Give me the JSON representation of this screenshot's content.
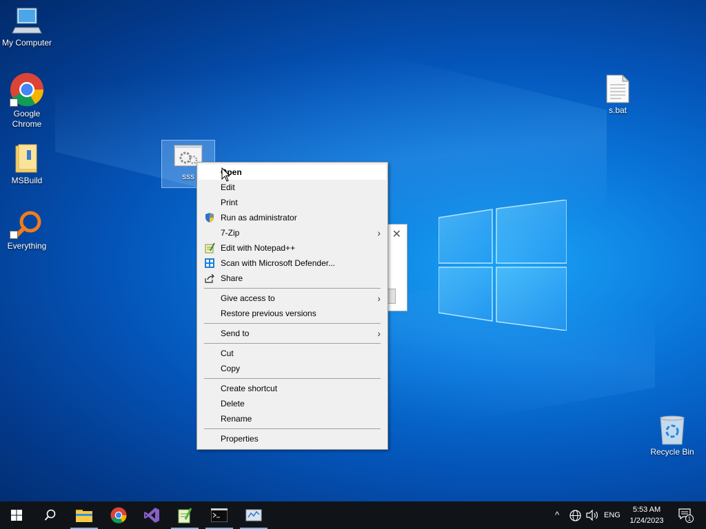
{
  "desktop": {
    "icons": [
      {
        "label": "My Computer"
      },
      {
        "label": "Google Chrome"
      },
      {
        "label": "MSBuild"
      },
      {
        "label": "Everything"
      },
      {
        "label": "sss"
      },
      {
        "label": "s.bat"
      },
      {
        "label": "Recycle Bin"
      }
    ]
  },
  "context_menu": {
    "items": [
      {
        "label": "Open",
        "bold": true
      },
      {
        "label": "Edit"
      },
      {
        "label": "Print"
      },
      {
        "label": "Run as administrator",
        "icon": "uac-shield-icon"
      },
      {
        "label": "7-Zip",
        "submenu": true
      },
      {
        "label": "Edit with Notepad++",
        "icon": "notepadpp-icon"
      },
      {
        "label": "Scan with Microsoft Defender...",
        "icon": "defender-icon"
      },
      {
        "label": "Share",
        "icon": "share-icon"
      },
      {
        "label": "Give access to",
        "submenu": true
      },
      {
        "label": "Restore previous versions"
      },
      {
        "label": "Send to",
        "submenu": true
      },
      {
        "label": "Cut"
      },
      {
        "label": "Copy"
      },
      {
        "label": "Create shortcut"
      },
      {
        "label": "Delete"
      },
      {
        "label": "Rename"
      },
      {
        "label": "Properties"
      }
    ],
    "submenu_arrow": "›"
  },
  "taskbar": {
    "apps": [
      "start-button",
      "search-button",
      "file-explorer",
      "chrome",
      "visual-studio",
      "notepadpp",
      "cmd",
      "task-app"
    ],
    "tray": {
      "overflow_caret": "^",
      "language": "ENG",
      "time": "5:53 AM",
      "date": "1/24/2023",
      "notifications_count": "1"
    }
  },
  "dialog_peek": {
    "close_glyph": "✕"
  }
}
